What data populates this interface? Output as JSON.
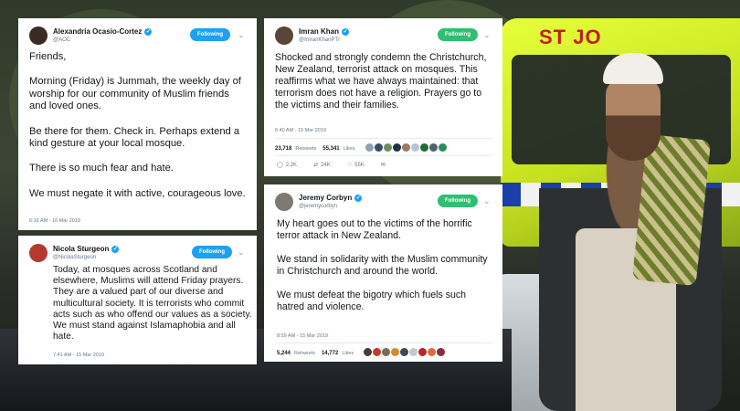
{
  "colors": {
    "follow_blue": "#1da1f2",
    "follow_green": "#2fbf71",
    "text": "#14171a",
    "muted": "#657786"
  },
  "tweets": [
    {
      "author": "Alexandria Ocasio-Cortez",
      "handle": "@AOC",
      "follow_label": "Following",
      "text": "Friends,\n\nMorning (Friday) is Jummah, the weekly day of worship for our community of Muslim friends and loved ones.\n\nBe there for them. Check in. Perhaps extend a kind gesture at your local mosque.\n\nThere is so much fear and hate.\n\nWe must negate it with active, courageous love.",
      "timestamp": "6:16 AM - 16 Mar 2019"
    },
    {
      "author": "Imran Khan",
      "handle": "@ImranKhanPTI",
      "follow_label": "Following",
      "text": "Shocked and strongly condemn the Christchurch, New Zealand, terrorist attack on mosques. This reaffirms what we have always maintained: that terrorism does not have a religion. Prayers go to the victims and their families.",
      "timestamp": "6:40 AM - 15 Mar 2019",
      "retweets": "23,718",
      "retweets_label": "Retweets",
      "likes": "55,341",
      "likes_label": "Likes",
      "replies": "2.2K",
      "rt_count": "24K",
      "like_count": "55K"
    },
    {
      "author": "Nicola Sturgeon",
      "handle": "@NicolaSturgeon",
      "follow_label": "Following",
      "text": "Today, at mosques across Scotland and elsewhere, Muslims will attend Friday prayers. They are a valued part of our diverse and multicultural society. It is terrorists who commit acts such as who offend our values as a society. We must stand against Islamaphobia and all hate.",
      "timestamp": "7:41 AM - 15 Mar 2019"
    },
    {
      "author": "Jeremy Corbyn",
      "handle": "@jeremycorbyn",
      "follow_label": "Following",
      "text": "My heart goes out to the victims of the horrific terror attack in New Zealand.\n\nWe stand in solidarity with the Muslim community in Christchurch and around the world.\n\nWe must defeat the bigotry which fuels such hatred and violence.",
      "timestamp": "8:59 AM - 15 Mar 2019",
      "retweets": "5,244",
      "retweets_label": "Retweets",
      "likes": "14,772",
      "likes_label": "Likes"
    }
  ],
  "background": {
    "ambulance_text": "ST JO"
  }
}
